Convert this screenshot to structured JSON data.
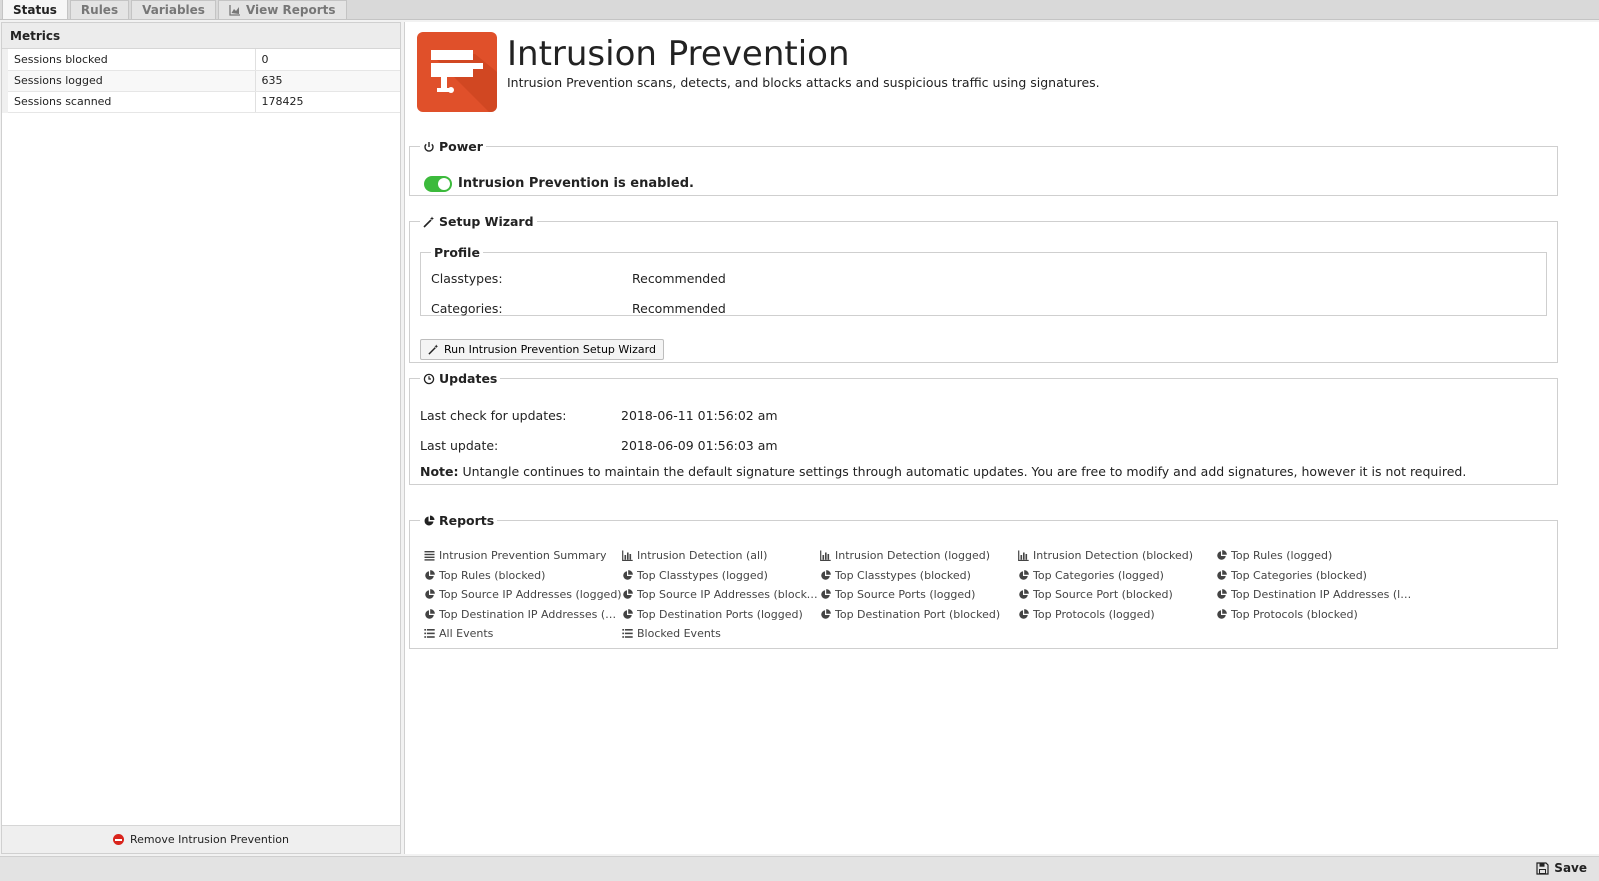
{
  "tabs": [
    {
      "label": "Status",
      "active": true
    },
    {
      "label": "Rules"
    },
    {
      "label": "Variables"
    },
    {
      "label": "View Reports",
      "icon": "chart-icon"
    }
  ],
  "metrics": {
    "header": "Metrics",
    "rows": [
      {
        "name": "Sessions blocked",
        "value": "0"
      },
      {
        "name": "Sessions logged",
        "value": "635"
      },
      {
        "name": "Sessions scanned",
        "value": "178425"
      }
    ],
    "remove_label": "Remove Intrusion Prevention"
  },
  "app": {
    "title": "Intrusion Prevention",
    "description": "Intrusion Prevention scans, detects, and blocks attacks and suspicious traffic using signatures.",
    "icon_color": "#e0502a"
  },
  "power": {
    "legend": "Power",
    "status_text": "Intrusion Prevention is enabled.",
    "toggle_color": "#3cba3c"
  },
  "wizard": {
    "legend": "Setup Wizard",
    "profile_legend": "Profile",
    "classtypes_label": "Classtypes:",
    "classtypes_value": "Recommended",
    "categories_label": "Categories:",
    "categories_value": "Recommended",
    "button_label": "Run Intrusion Prevention Setup Wizard"
  },
  "updates": {
    "legend": "Updates",
    "last_check_label": "Last check for updates:",
    "last_check_value": "2018-06-11 01:56:02 am",
    "last_update_label": "Last update:",
    "last_update_value": "2018-06-09 01:56:03 am",
    "note_label": "Note:",
    "note_text": "Untangle continues to maintain the default signature settings through automatic updates. You are free to modify and add signatures, however it is not required."
  },
  "reports": {
    "legend": "Reports",
    "items": [
      {
        "label": "Intrusion Prevention Summary",
        "icon": "text-icon"
      },
      {
        "label": "Intrusion Detection (all)",
        "icon": "bar-chart-icon"
      },
      {
        "label": "Intrusion Detection (logged)",
        "icon": "bar-chart-icon"
      },
      {
        "label": "Intrusion Detection (blocked)",
        "icon": "bar-chart-icon"
      },
      {
        "label": "Top Rules (logged)",
        "icon": "pie-chart-icon"
      },
      {
        "label": "Top Rules (blocked)",
        "icon": "pie-chart-icon"
      },
      {
        "label": "Top Classtypes (logged)",
        "icon": "pie-chart-icon"
      },
      {
        "label": "Top Classtypes (blocked)",
        "icon": "pie-chart-icon"
      },
      {
        "label": "Top Categories (logged)",
        "icon": "pie-chart-icon"
      },
      {
        "label": "Top Categories (blocked)",
        "icon": "pie-chart-icon"
      },
      {
        "label": "Top Source IP Addresses (logged)",
        "icon": "pie-chart-icon"
      },
      {
        "label": "Top Source IP Addresses (blocke...",
        "icon": "pie-chart-icon"
      },
      {
        "label": "Top Source Ports (logged)",
        "icon": "pie-chart-icon"
      },
      {
        "label": "Top Source Port (blocked)",
        "icon": "pie-chart-icon"
      },
      {
        "label": "Top Destination IP Addresses (lo...",
        "icon": "pie-chart-icon"
      },
      {
        "label": "Top Destination IP Addresses (bl...",
        "icon": "pie-chart-icon"
      },
      {
        "label": "Top Destination Ports (logged)",
        "icon": "pie-chart-icon"
      },
      {
        "label": "Top Destination Port (blocked)",
        "icon": "pie-chart-icon"
      },
      {
        "label": "Top Protocols (logged)",
        "icon": "pie-chart-icon"
      },
      {
        "label": "Top Protocols (blocked)",
        "icon": "pie-chart-icon"
      },
      {
        "label": "All Events",
        "icon": "list-icon"
      },
      {
        "label": "Blocked Events",
        "icon": "list-icon"
      }
    ]
  },
  "footer": {
    "save_label": "Save"
  }
}
